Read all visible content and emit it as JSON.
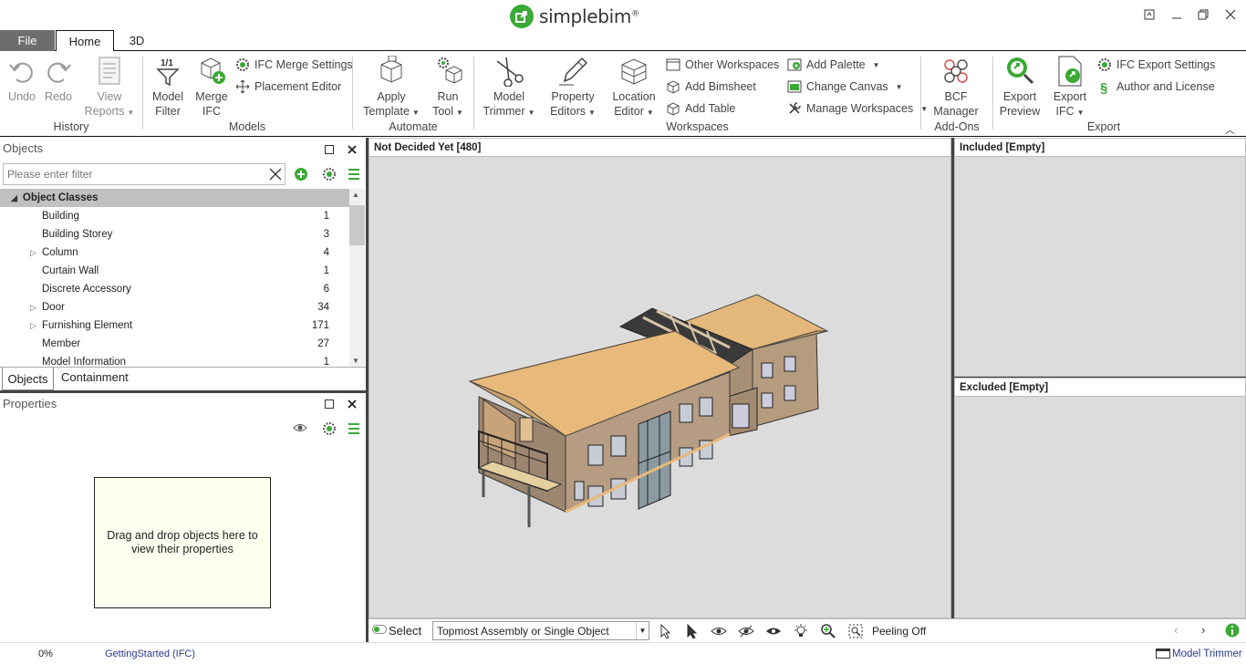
{
  "app": {
    "logo_text": "simplebim",
    "logo_reg": "®"
  },
  "window_buttons": [
    "restore-down",
    "minimize",
    "maximize",
    "close"
  ],
  "tabs": {
    "file": "File",
    "home": "Home",
    "threed": "3D"
  },
  "ribbon": {
    "history": {
      "label": "History",
      "undo": "Undo",
      "redo": "Redo",
      "view_reports_1": "View",
      "view_reports_2": "Reports"
    },
    "models": {
      "label": "Models",
      "model_filter_1": "Model",
      "model_filter_2": "Filter",
      "merge_ifc_1": "Merge",
      "merge_ifc_2": "IFC",
      "ifc_merge_settings": "IFC Merge Settings",
      "placement_editor": "Placement Editor"
    },
    "automate": {
      "label": "Automate",
      "apply_template_1": "Apply",
      "apply_template_2": "Template",
      "run_tool_1": "Run",
      "run_tool_2": "Tool"
    },
    "workspaces": {
      "label": "Workspaces",
      "model_trimmer_1": "Model",
      "model_trimmer_2": "Trimmer",
      "property_editors_1": "Property",
      "property_editors_2": "Editors",
      "location_editor_1": "Location",
      "location_editor_2": "Editor",
      "other_workspaces": "Other Workspaces",
      "add_bimsheet": "Add Bimsheet",
      "add_table": "Add Table",
      "add_palette": "Add Palette",
      "change_canvas": "Change Canvas",
      "manage_workspaces": "Manage Workspaces"
    },
    "addons": {
      "label": "Add-Ons",
      "bcf_manager_1": "BCF",
      "bcf_manager_2": "Manager"
    },
    "export": {
      "label": "Export",
      "export_preview_1": "Export",
      "export_preview_2": "Preview",
      "export_ifc_1": "Export",
      "export_ifc_2": "IFC",
      "ifc_export_settings": "IFC Export Settings",
      "author_license": "Author and License"
    }
  },
  "objects_panel": {
    "title": "Objects",
    "filter_placeholder": "Please enter filter",
    "root": "Object Classes",
    "items": [
      {
        "label": "Building",
        "count": "1",
        "expandable": false
      },
      {
        "label": "Building Storey",
        "count": "3",
        "expandable": false
      },
      {
        "label": "Column",
        "count": "4",
        "expandable": true
      },
      {
        "label": "Curtain Wall",
        "count": "1",
        "expandable": false
      },
      {
        "label": "Discrete Accessory",
        "count": "6",
        "expandable": false
      },
      {
        "label": "Door",
        "count": "34",
        "expandable": true
      },
      {
        "label": "Furnishing Element",
        "count": "171",
        "expandable": true
      },
      {
        "label": "Member",
        "count": "27",
        "expandable": false
      },
      {
        "label": "Model Information",
        "count": "1",
        "expandable": false
      }
    ],
    "tab_objects": "Objects",
    "tab_containment": "Containment"
  },
  "properties_panel": {
    "title": "Properties",
    "dropzone_text": "Drag and drop objects here to view their properties"
  },
  "viewport": {
    "title": "Not Decided Yet [480]"
  },
  "included": {
    "title": "Included [Empty]"
  },
  "excluded": {
    "title": "Excluded [Empty]"
  },
  "view_toolbar": {
    "select_label": "Select",
    "selection_mode": "Topmost Assembly or Single Object",
    "peeling": "Peeling Off"
  },
  "status": {
    "progress": "0%",
    "file": "GettingStarted (IFC)",
    "workspace": "Model Trimmer"
  },
  "colors": {
    "brand_green": "#3aa935",
    "file_tab": "#6d6d6d",
    "viewport_bg": "#dcdcdc",
    "dropzone_bg": "#fffff0"
  }
}
